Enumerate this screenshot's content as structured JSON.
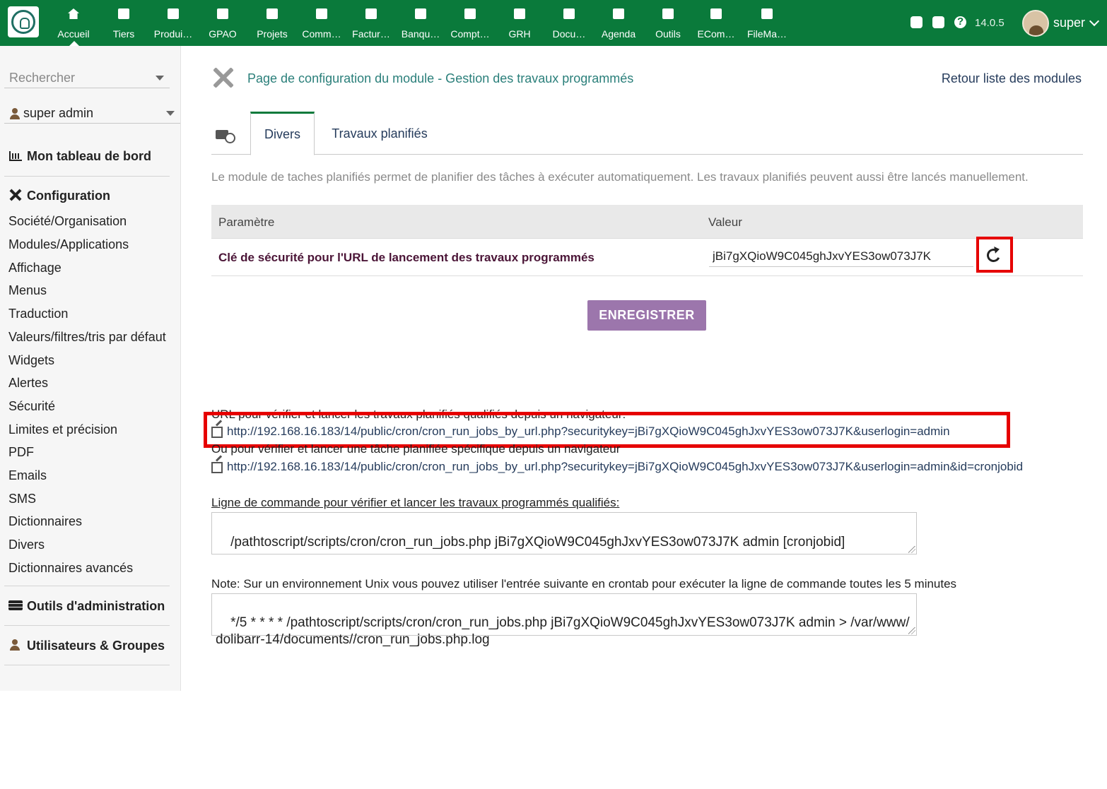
{
  "topbar": {
    "menu": [
      {
        "label": "Accueil",
        "icon": "home-icon"
      },
      {
        "label": "Tiers",
        "icon": "building-icon"
      },
      {
        "label": "Produi…",
        "icon": "cube-icon"
      },
      {
        "label": "GPAO",
        "icon": "cubes-icon"
      },
      {
        "label": "Projets",
        "icon": "sitemap-icon"
      },
      {
        "label": "Comm…",
        "icon": "briefcase-icon"
      },
      {
        "label": "Factur…",
        "icon": "coins-icon"
      },
      {
        "label": "Banqu…",
        "icon": "bank-icon"
      },
      {
        "label": "Compt…",
        "icon": "search-dollar-icon"
      },
      {
        "label": "GRH",
        "icon": "user-tie-icon"
      },
      {
        "label": "Docu…",
        "icon": "folder-open-icon"
      },
      {
        "label": "Agenda",
        "icon": "calendar-icon"
      },
      {
        "label": "Outils",
        "icon": "wrench-icon"
      },
      {
        "label": "ECom…",
        "icon": "sticky-note-icon"
      },
      {
        "label": "FileMa…",
        "icon": "sticky-note-icon"
      }
    ],
    "version": "14.0.5",
    "user": "super",
    "accent": "#0a7a3b"
  },
  "sidebar": {
    "search_placeholder": "Rechercher",
    "user_select": "super admin",
    "dashboard": "Mon tableau de bord",
    "config_heading": "Configuration",
    "config_items": [
      "Société/Organisation",
      "Modules/Applications",
      "Affichage",
      "Menus",
      "Traduction",
      "Valeurs/filtres/tris par défaut",
      "Widgets",
      "Alertes",
      "Sécurité",
      "Limites et précision",
      "PDF",
      "Emails",
      "SMS",
      "Dictionnaires",
      "Divers",
      "Dictionnaires avancés"
    ],
    "admin_tools": "Outils d'administration",
    "users_groups": "Utilisateurs & Groupes"
  },
  "main": {
    "title": "Page de configuration du module - Gestion des travaux programmés",
    "back_link": "Retour liste des modules",
    "tabs": [
      "Divers",
      "Travaux planifiés"
    ],
    "intro": "Le module de taches planifiés permet de planifier des tâches à exécuter automatiquement. Les travaux planifiés peuvent aussi être lancés manuellement.",
    "table": {
      "col_param": "Paramètre",
      "col_value": "Valeur",
      "row_label": "Clé de sécurité pour l'URL de lancement des travaux programmés",
      "row_value": "jBi7gXQioW9C045ghJxvYES3ow073J7K"
    },
    "save_label": "ENREGISTRER",
    "url_label_1": "URL pour vérifier et lancer les travaux planifiés qualifiés depuis un navigateur:",
    "url_1": "http://192.168.16.183/14/public/cron/cron_run_jobs_by_url.php?securitykey=jBi7gXQioW9C045ghJxvYES3ow073J7K&userlogin=admin",
    "url_label_2": "Ou pour vérifier et lancer une tâche planifiée spécifique depuis un navigateur",
    "url_2": "http://192.168.16.183/14/public/cron/cron_run_jobs_by_url.php?securitykey=jBi7gXQioW9C045ghJxvYES3ow073J7K&userlogin=admin&id=cronjobid",
    "cmd_label": "Ligne de commande pour vérifier et lancer les travaux programmés qualifiés:",
    "cmd_value": "/pathtoscript/scripts/cron/cron_run_jobs.php jBi7gXQioW9C045ghJxvYES3ow073J7K admin [cronjobid]",
    "note_label": "Note: Sur un environnement Unix vous pouvez utiliser l'entrée suivante en crontab pour exécuter la ligne de commande toutes les 5 minutes",
    "crontab_value": "*/5 * * * * /pathtoscript/scripts/cron/cron_run_jobs.php jBi7gXQioW9C045ghJxvYES3ow073J7K admin > /var/www/dolibarr-14/documents//cron_run_jobs.php.log"
  }
}
